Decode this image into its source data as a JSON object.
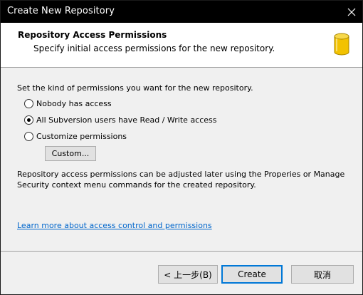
{
  "window": {
    "title": "Create New Repository"
  },
  "header": {
    "title": "Repository Access Permissions",
    "subtitle": "Specify initial access permissions for the new repository.",
    "icon": "database-icon"
  },
  "content": {
    "instruction": "Set the kind of permissions you want for the new repository.",
    "options": [
      {
        "label": "Nobody has access",
        "checked": false
      },
      {
        "label": "All Subversion users have Read / Write access",
        "checked": true
      },
      {
        "label": "Customize permissions",
        "checked": false
      }
    ],
    "custom_button": "Custom...",
    "note": "Repository access permissions can be adjusted later using the Properies or Manage Security context menu commands for the created repository.",
    "learn_more_link": "Learn more about access control and permissions"
  },
  "footer": {
    "back_button": "< 上一步(B)",
    "create_button": "Create",
    "cancel_button": "取消"
  },
  "colors": {
    "titlebar": "#000000",
    "link": "#0066cc",
    "focus_border": "#0078d7",
    "icon_gold": "#f2c200"
  }
}
